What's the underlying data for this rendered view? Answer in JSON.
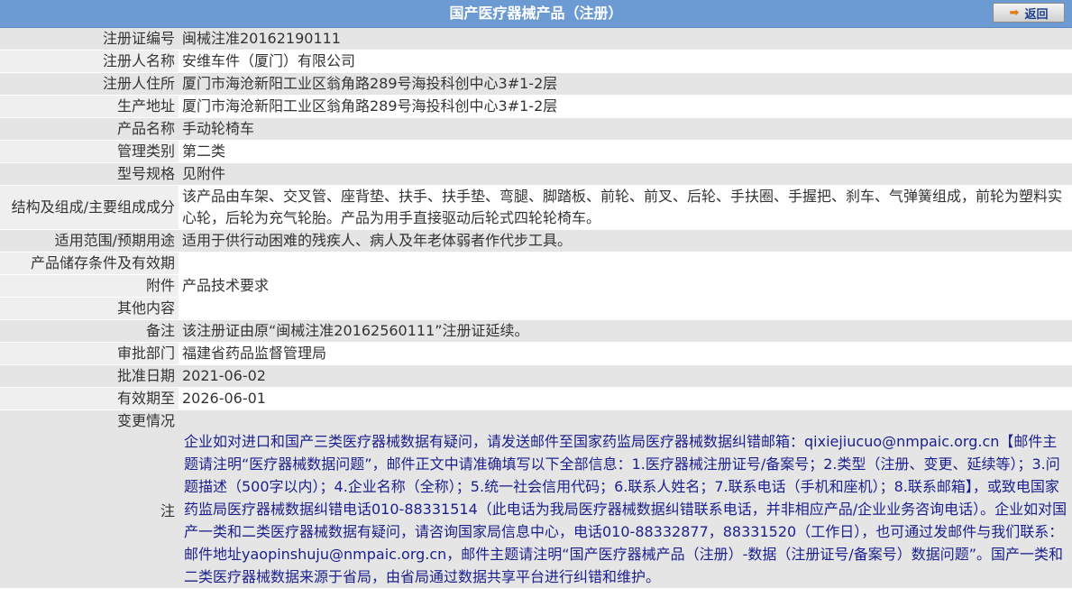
{
  "header": {
    "title": "国产医疗器械产品（注册）",
    "back_label": "返回"
  },
  "rows": [
    {
      "label": "注册证编号",
      "value": "闽械注准20162190111"
    },
    {
      "label": "注册人名称",
      "value": "安维车件（厦门）有限公司"
    },
    {
      "label": "注册人住所",
      "value": "厦门市海沧新阳工业区翁角路289号海投科创中心3#1-2层"
    },
    {
      "label": "生产地址",
      "value": "厦门市海沧新阳工业区翁角路289号海投科创中心3#1-2层"
    },
    {
      "label": "产品名称",
      "value": "手动轮椅车"
    },
    {
      "label": "管理类别",
      "value": "第二类"
    },
    {
      "label": "型号规格",
      "value": "见附件"
    },
    {
      "label": "结构及组成/主要组成成分",
      "value": "该产品由车架、交叉管、座背垫、扶手、扶手垫、弯腿、脚踏板、前轮、前叉、后轮、手扶圈、手握把、刹车、气弹簧组成，前轮为塑料实心轮，后轮为充气轮胎。产品为用手直接驱动后轮式四轮轮椅车。"
    },
    {
      "label": "适用范围/预期用途",
      "value": "适用于供行动困难的残疾人、病人及年老体弱者作代步工具。"
    },
    {
      "label": "产品储存条件及有效期",
      "value": ""
    },
    {
      "label": "附件",
      "value": "产品技术要求"
    },
    {
      "label": "其他内容",
      "value": ""
    },
    {
      "label": "备注",
      "value": "该注册证由原“闽械注准20162560111”注册证延续。"
    },
    {
      "label": "审批部门",
      "value": "福建省药品监督管理局"
    },
    {
      "label": "批准日期",
      "value": "2021-06-02"
    },
    {
      "label": "有效期至",
      "value": "2026-06-01"
    },
    {
      "label": "变更情况",
      "value": ""
    }
  ],
  "note": {
    "label": "注",
    "text": "企业如对进口和国产三类医疗器械数据有疑问，请发送邮件至国家药监局医疗器械数据纠错邮箱：qixiejiucuo@nmpaic.org.cn【邮件主题请注明“医疗器械数据问题”，邮件正文中请准确填写以下全部信息：1.医疗器械注册证号/备案号；2.类型（注册、变更、延续等）；3.问题描述（500字以内）；4.企业名称（全称）；5.统一社会信用代码；6.联系人姓名；7.联系电话（手机和座机）；8.联系邮箱】，或致电国家药监局医疗器械数据纠错电话010-88331514（此电话为我局医疗器械数据纠错联系电话，并非相应产品/企业业务咨询电话）。企业如对国产一类和二类医疗器械数据有疑问，请咨询国家局信息中心，电话010-88332877，88331520（工作日），也可通过发邮件与我们联系：邮件地址yaopinshuju@nmpaic.org.cn，邮件主题请注明“国产医疗器械产品（注册）-数据（注册证号/备案号）数据问题”。国产一类和二类医疗器械数据来源于省局，由省局通过数据共享平台进行纠错和维护。"
  },
  "colors": {
    "header_bg": "#6b9bd2",
    "label_bg": "#efefef",
    "alt_row_bg": "#e5e5e5",
    "note_text": "#1a1f8c"
  }
}
